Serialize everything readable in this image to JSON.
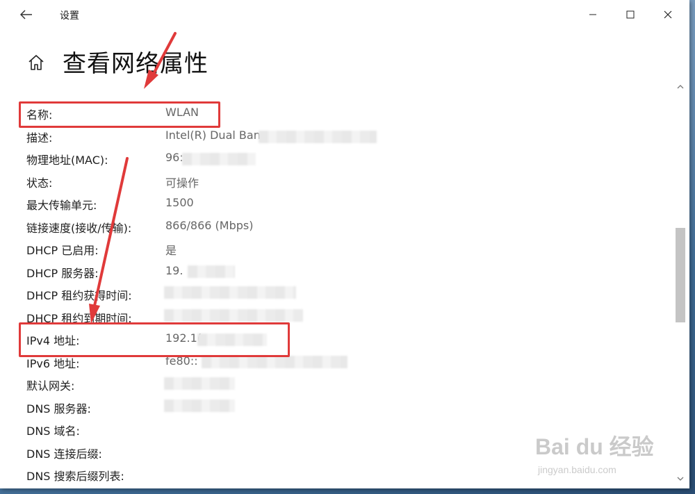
{
  "window": {
    "title": "设置"
  },
  "page": {
    "title": "查看网络属性"
  },
  "properties": [
    {
      "label": "名称:",
      "value": "WLAN"
    },
    {
      "label": "描述:",
      "value": "Intel(R) Dual Ban"
    },
    {
      "label": "物理地址(MAC):",
      "value": "96:"
    },
    {
      "label": "状态:",
      "value": "可操作"
    },
    {
      "label": "最大传输单元:",
      "value": "1500"
    },
    {
      "label": "链接速度(接收/传输):",
      "value": "866/866 (Mbps)"
    },
    {
      "label": "DHCP 已启用:",
      "value": "是"
    },
    {
      "label": "DHCP 服务器:",
      "value": "19."
    },
    {
      "label": "DHCP 租约获得时间:",
      "value": ""
    },
    {
      "label": "DHCP 租约到期时间:",
      "value": ""
    },
    {
      "label": "IPv4 地址:",
      "value": "192.1("
    },
    {
      "label": "IPv6 地址:",
      "value": "fe80::"
    },
    {
      "label": "默认网关:",
      "value": ""
    },
    {
      "label": "DNS 服务器:",
      "value": ""
    },
    {
      "label": "DNS 域名:",
      "value": ""
    },
    {
      "label": "DNS 连接后缀:",
      "value": ""
    },
    {
      "label": "DNS 搜索后缀列表:",
      "value": ""
    }
  ],
  "watermark": {
    "brand": "Bai du 经验",
    "url": "jingyan.baidu.com"
  },
  "colors": {
    "highlight": "#e03a3a",
    "window_bg": "#ffffff",
    "label": "#1f1f1f",
    "value": "#666666"
  }
}
